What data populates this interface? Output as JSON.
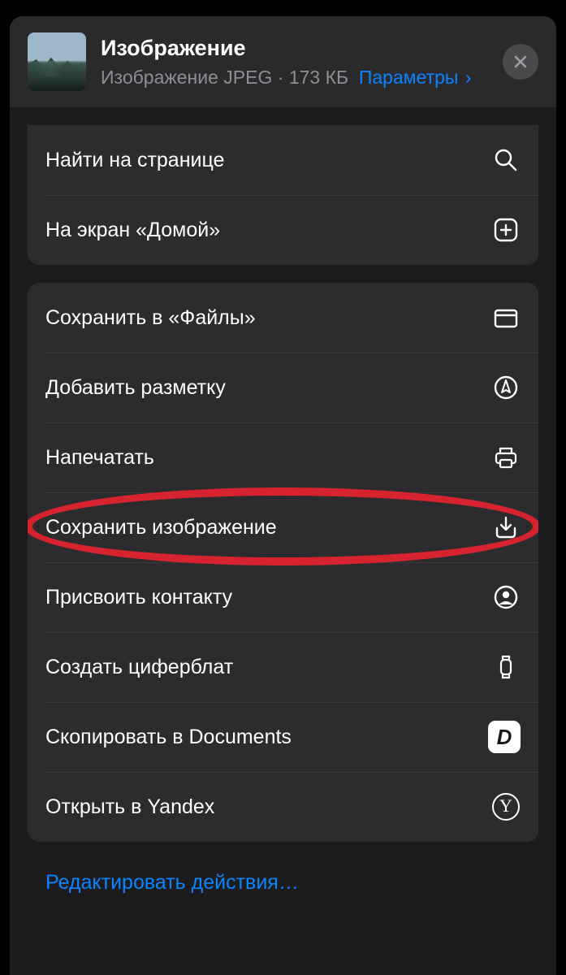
{
  "header": {
    "title": "Изображение",
    "subtitle_type": "Изображение JPEG",
    "subtitle_sep": " · ",
    "subtitle_size": "173 КБ",
    "options_link": "Параметры",
    "options_chevron": "›"
  },
  "group1": [
    {
      "label": "Найти на странице",
      "icon": "search",
      "name": "find-on-page"
    },
    {
      "label": "На экран «Домой»",
      "icon": "plus-square",
      "name": "add-to-home-screen"
    }
  ],
  "group2": [
    {
      "label": "Сохранить в «Файлы»",
      "icon": "folder",
      "name": "save-to-files"
    },
    {
      "label": "Добавить разметку",
      "icon": "markup",
      "name": "markup"
    },
    {
      "label": "Напечатать",
      "icon": "printer",
      "name": "print"
    },
    {
      "label": "Сохранить изображение",
      "icon": "download-square",
      "name": "save-image",
      "highlighted": true
    },
    {
      "label": "Присвоить контакту",
      "icon": "person-circle",
      "name": "assign-to-contact"
    },
    {
      "label": "Создать циферблат",
      "icon": "watch",
      "name": "create-watch-face"
    },
    {
      "label": "Скопировать в Documents",
      "icon": "app-documents",
      "name": "copy-to-documents"
    },
    {
      "label": "Открыть в Yandex",
      "icon": "app-yandex",
      "name": "open-in-yandex"
    }
  ],
  "edit_actions": "Редактировать действия…",
  "annotation": {
    "highlight_color": "#d7232f"
  }
}
